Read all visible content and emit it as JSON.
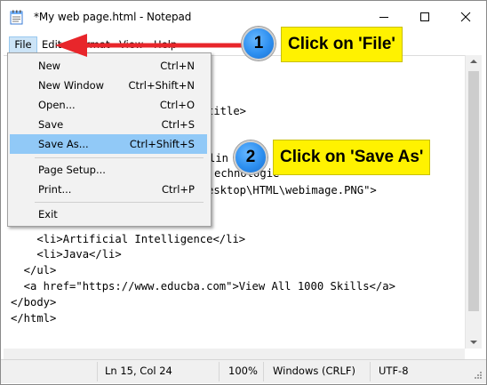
{
  "window": {
    "title": "*My web page.html - Notepad",
    "icon": "notepad-icon"
  },
  "menubar": {
    "items": [
      {
        "label": "File"
      },
      {
        "label": "Edit"
      },
      {
        "label": "Format"
      },
      {
        "label": "View"
      },
      {
        "label": "Help"
      }
    ]
  },
  "file_menu": {
    "items": [
      {
        "label": "New",
        "shortcut": "Ctrl+N"
      },
      {
        "label": "New Window",
        "shortcut": "Ctrl+Shift+N"
      },
      {
        "label": "Open...",
        "shortcut": "Ctrl+O"
      },
      {
        "label": "Save",
        "shortcut": "Ctrl+S"
      },
      {
        "label": "Save As...",
        "shortcut": "Ctrl+Shift+S",
        "highlighted": true
      },
      {
        "label": "Page Setup...",
        "shortcut": ""
      },
      {
        "label": "Print...",
        "shortcut": "Ctrl+P"
      },
      {
        "label": "Exit",
        "shortcut": ""
      }
    ]
  },
  "editor": {
    "visible_fragments": [
      "title>",
      "lin",
      "echnologie",
      "esktop\\HTML\\webimage.PNG\">",
      "    <li>Artificial Intelligence</li>",
      "    <li>Java</li>",
      "  </ul>",
      "  <a href=\"https://www.educba.com\">View All 1000 Skills</a>",
      "</body>",
      "</html>"
    ]
  },
  "status": {
    "position": "Ln 15, Col 24",
    "zoom": "100%",
    "line_ending": "Windows (CRLF)",
    "encoding": "UTF-8"
  },
  "callouts": [
    {
      "number": "1",
      "text": "Click on 'File'"
    },
    {
      "number": "2",
      "text": "Click on 'Save As'"
    }
  ],
  "colors": {
    "menu_highlight": "#91c9f7",
    "callout_box": "#fff200",
    "callout_circle": "#2d8ff0",
    "arrow": "#e8262b"
  }
}
